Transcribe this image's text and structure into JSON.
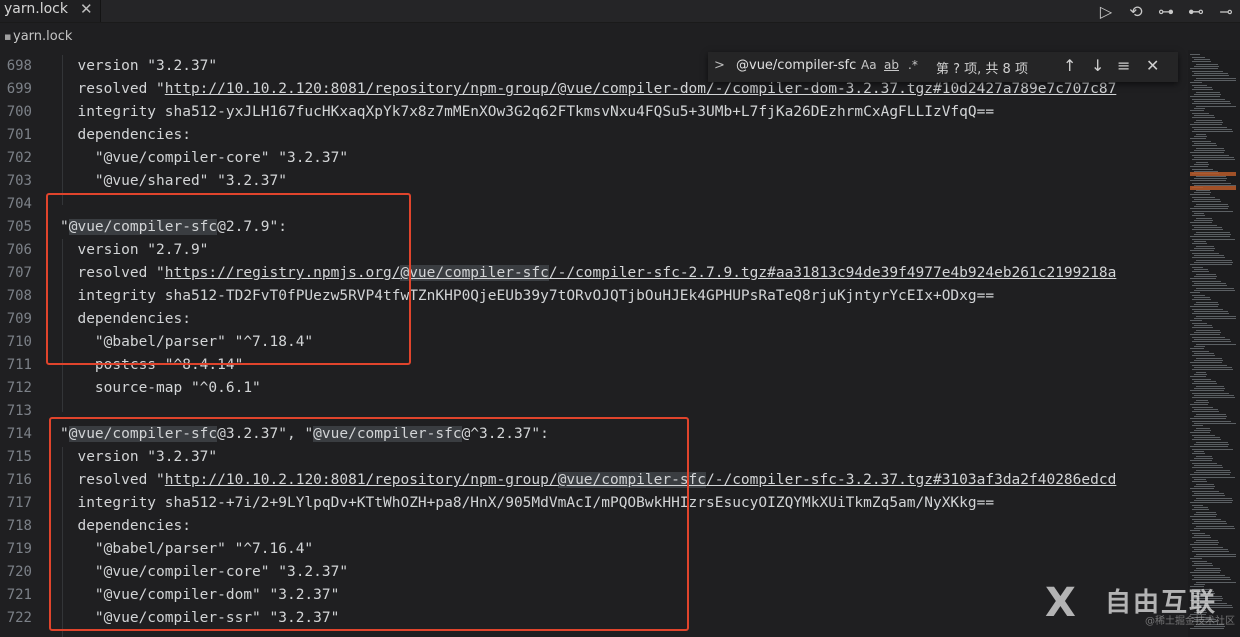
{
  "tab": {
    "label": "yarn.lock",
    "close": "✕"
  },
  "breadcrumb": {
    "label": "yarn.lock"
  },
  "run_actions": [
    "▷",
    "⟲",
    "⊶",
    "⊷",
    "⊸"
  ],
  "find_widget": {
    "query": "@vue/compiler-sfc",
    "match_case": "Aa",
    "whole_word": "ab",
    "regex": ".*",
    "count": "第 ? 项, 共 8 项",
    "prev": "↑",
    "next": "↓",
    "selection": "≡",
    "close": "✕"
  },
  "lines": [
    {
      "n": "698",
      "text": "  version \"3.2.37\""
    },
    {
      "n": "699",
      "pre": "  resolved \"",
      "url": "http://10.10.2.120:8081/repository/npm-group/@vue/compiler-dom/-/compiler-dom-3.2.37.tgz#10d2427a789e7c707c87",
      "post": ""
    },
    {
      "n": "700",
      "text": "  integrity sha512-yxJLH167fucHKxaqXpYk7x8z7mMEnXOw3G2q62FTkmsvNxu4FQSu5+3UMb+L7fjKa26DEzhrmCxAgFLLIzVfqQ=="
    },
    {
      "n": "701",
      "text": "  dependencies:"
    },
    {
      "n": "702",
      "text": "    \"@vue/compiler-core\" \"3.2.37\""
    },
    {
      "n": "703",
      "text": "    \"@vue/shared\" \"3.2.37\""
    },
    {
      "n": "704",
      "text": ""
    },
    {
      "n": "705",
      "text": "\"@vue/compiler-sfc@2.7.9\":"
    },
    {
      "n": "706",
      "text": "  version \"2.7.9\""
    },
    {
      "n": "707",
      "pre": "  resolved \"",
      "url": "https://registry.npmjs.org/@vue/compiler-sfc/-/compiler-sfc-2.7.9.tgz#aa31813c94de39f4977e4b924eb261c2199218a",
      "post": ""
    },
    {
      "n": "708",
      "text": "  integrity sha512-TD2FvT0fPUezw5RVP4tfwTZnKHP0QjeEUb39y7tORvOJQTjbOuHJEk4GPHUPsRaTeQ8rjuKjntyrYcEIx+ODxg=="
    },
    {
      "n": "709",
      "text": "  dependencies:"
    },
    {
      "n": "710",
      "text": "    \"@babel/parser\" \"^7.18.4\""
    },
    {
      "n": "711",
      "text": "    postcss \"^8.4.14\""
    },
    {
      "n": "712",
      "text": "    source-map \"^0.6.1\""
    },
    {
      "n": "713",
      "text": ""
    },
    {
      "n": "714",
      "text": "\"@vue/compiler-sfc@3.2.37\", \"@vue/compiler-sfc@^3.2.37\":"
    },
    {
      "n": "715",
      "text": "  version \"3.2.37\""
    },
    {
      "n": "716",
      "pre": "  resolved \"",
      "url": "http://10.10.2.120:8081/repository/npm-group/@vue/compiler-sfc/-/compiler-sfc-3.2.37.tgz#3103af3da2f40286edcd",
      "post": ""
    },
    {
      "n": "717",
      "text": "  integrity sha512-+7i/2+9LYlpqDv+KTtWhOZH+pa8/HnX/905MdVmAcI/mPQOBwkHHIzrsEsucyOIZQYMkXUiTkmZq5am/NyXKkg=="
    },
    {
      "n": "718",
      "text": "  dependencies:"
    },
    {
      "n": "719",
      "text": "    \"@babel/parser\" \"^7.16.4\""
    },
    {
      "n": "720",
      "text": "    \"@vue/compiler-core\" \"3.2.37\""
    },
    {
      "n": "721",
      "text": "    \"@vue/compiler-dom\" \"3.2.37\""
    },
    {
      "n": "722",
      "text": "    \"@vue/compiler-ssr\" \"3.2.37\""
    }
  ],
  "watermark": {
    "logo": "X",
    "title": "自由互联",
    "subtitle": "@稀土掘金技术社区"
  },
  "colors": {
    "highlight_box": "#e0442c",
    "background": "#1f1f21"
  }
}
